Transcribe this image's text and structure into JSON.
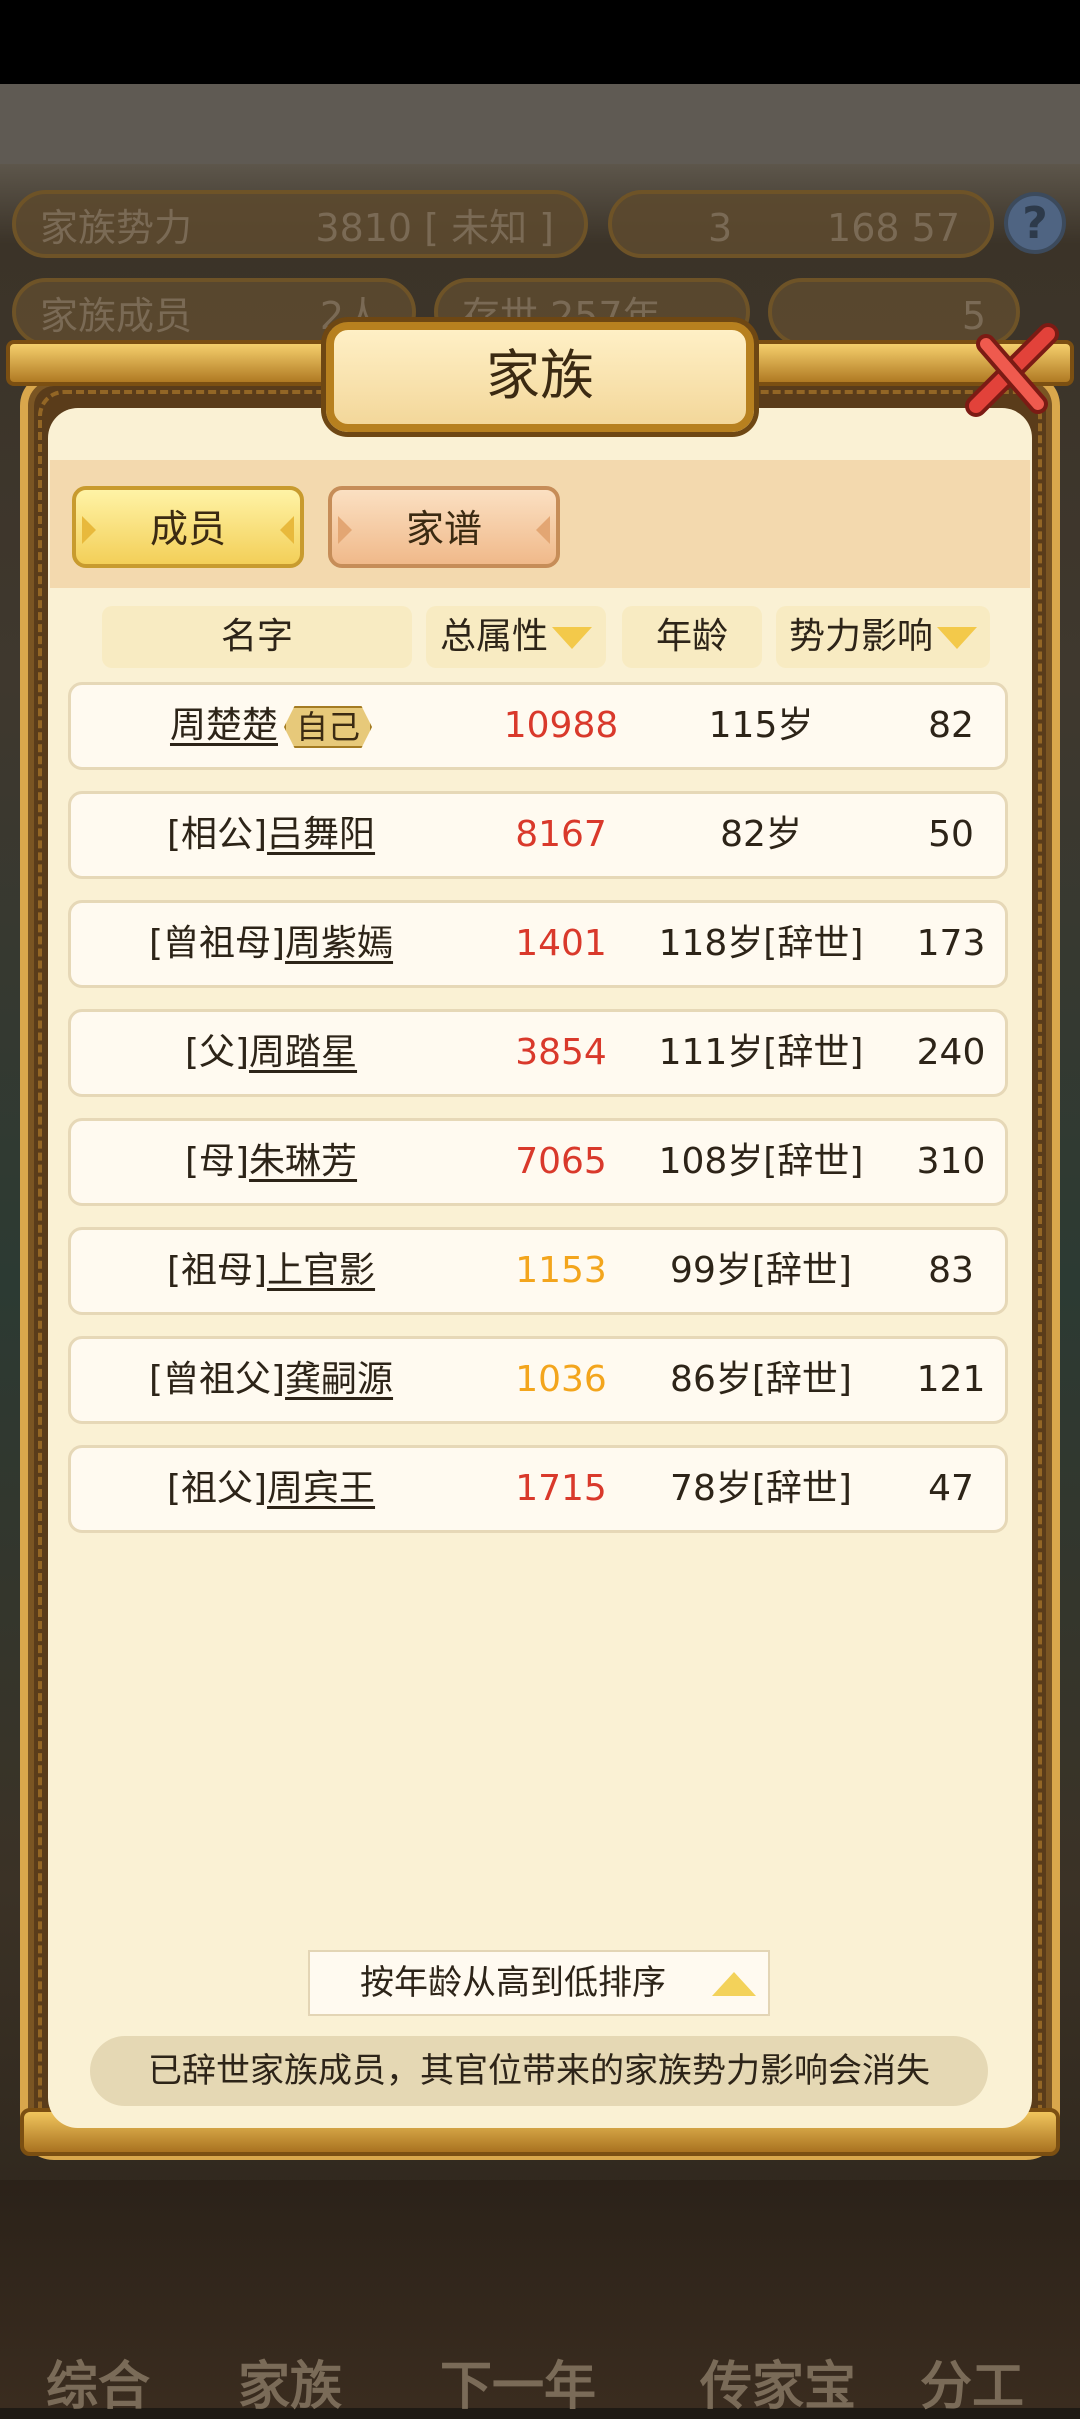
{
  "background": {
    "stats": [
      {
        "label": "家族势力",
        "value": "3810 [ 未知 ]"
      },
      {
        "label": "3",
        "value": "168  57"
      },
      {
        "label": "家族成员",
        "value": "2人"
      },
      {
        "label": "存世 257年",
        "value": ""
      },
      {
        "label": "",
        "value": "5"
      }
    ],
    "help_glyph": "?",
    "nav": [
      "综合",
      "家族",
      "下一年",
      "传家宝",
      "分工"
    ]
  },
  "dialog": {
    "title": "家族",
    "tabs": {
      "members": "成员",
      "tree": "家谱"
    },
    "columns": {
      "name": "名字",
      "attr": "总属性",
      "age": "年龄",
      "influence": "势力影响"
    },
    "self_badge": "自己",
    "rows": [
      {
        "prefix": "",
        "name": "周楚楚",
        "self": true,
        "attr": "10988",
        "attr_color": "red",
        "age": "115岁",
        "influence": "82"
      },
      {
        "prefix": "[相公]",
        "name": "吕舞阳",
        "self": false,
        "attr": "8167",
        "attr_color": "red",
        "age": "82岁",
        "influence": "50"
      },
      {
        "prefix": "[曾祖母]",
        "name": "周紫嫣",
        "self": false,
        "attr": "1401",
        "attr_color": "red",
        "age": "118岁[辞世]",
        "influence": "173"
      },
      {
        "prefix": "[父]",
        "name": "周踏星",
        "self": false,
        "attr": "3854",
        "attr_color": "red",
        "age": "111岁[辞世]",
        "influence": "240"
      },
      {
        "prefix": "[母]",
        "name": "朱琳芳",
        "self": false,
        "attr": "7065",
        "attr_color": "red",
        "age": "108岁[辞世]",
        "influence": "310"
      },
      {
        "prefix": "[祖母]",
        "name": "上官影",
        "self": false,
        "attr": "1153",
        "attr_color": "orange",
        "age": "99岁[辞世]",
        "influence": "83"
      },
      {
        "prefix": "[曾祖父]",
        "name": "龚嗣源",
        "self": false,
        "attr": "1036",
        "attr_color": "orange",
        "age": "86岁[辞世]",
        "influence": "121"
      },
      {
        "prefix": "[祖父]",
        "name": "周宾王",
        "self": false,
        "attr": "1715",
        "attr_color": "red",
        "age": "78岁[辞世]",
        "influence": "47"
      }
    ],
    "sort_label": "按年龄从高到低排序",
    "notice": "已辞世家族成员，其官位带来的家族势力影响会消失"
  }
}
